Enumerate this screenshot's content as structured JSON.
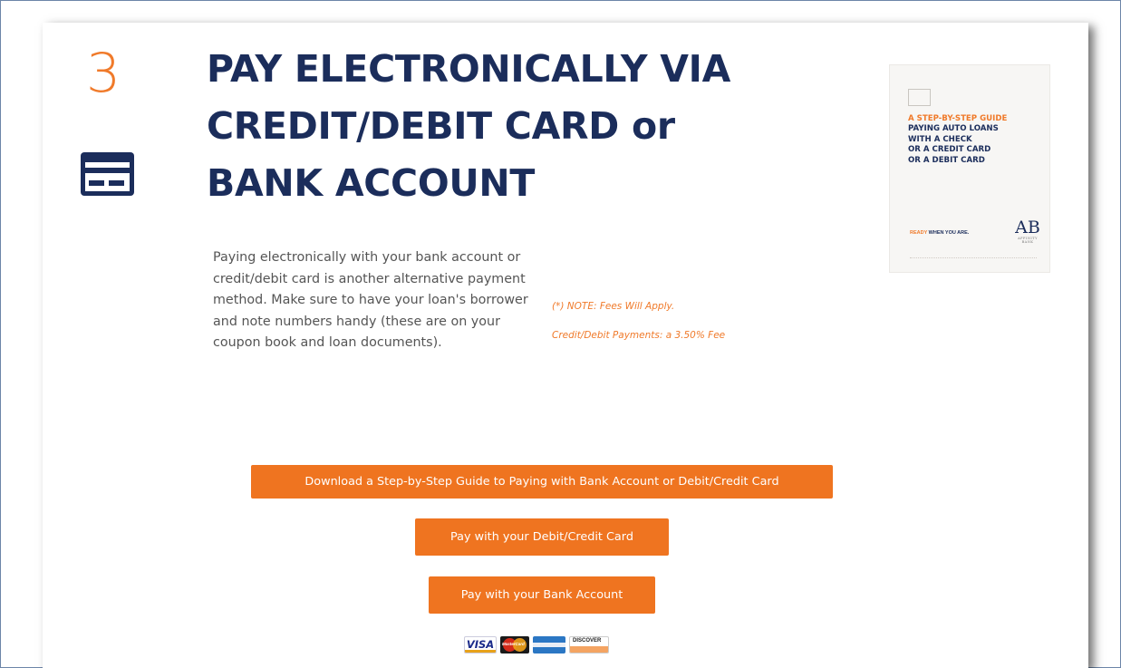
{
  "step": {
    "number": "3",
    "icon": "credit-card-icon"
  },
  "title": {
    "line1": "PAY ELECTRONICALLY VIA",
    "line2": "CREDIT/DEBIT CARD or",
    "line3": "BANK ACCOUNT"
  },
  "body": {
    "text": "Paying electronically with your bank account or credit/debit card is another alternative payment method. Make sure to have your loan's borrower and note numbers handy (these are on your coupon book and loan documents)."
  },
  "notes": {
    "fees": "(*) NOTE: Fees Will Apply.",
    "credit": "Credit/Debit Payments: a 3.50% Fee"
  },
  "guide_thumbnail": {
    "headline": [
      "A STEP-BY-STEP GUIDE",
      "PAYING AUTO LOANS",
      "WITH A CHECK",
      "OR A CREDIT CARD",
      "OR A DEBIT CARD"
    ],
    "ready_prefix": "READY",
    "ready_suffix": " WHEN YOU ARE.",
    "logo": "AB",
    "logo_sub": "AFFINITY BANK"
  },
  "buttons": {
    "guide": "Download a Step-by-Step Guide to Paying with Bank Account or Debit/Credit Card",
    "card": "Pay with your Debit/Credit Card",
    "bank": "Pay with your Bank Account"
  },
  "payment_logos": {
    "visa": "VISA",
    "mastercard": "MasterCard",
    "amex": "AMERICAN EXPRESS",
    "discover": "DISCOVER"
  },
  "colors": {
    "accent": "#ef7420",
    "navy": "#1b2d5b",
    "body_text": "#555555"
  }
}
